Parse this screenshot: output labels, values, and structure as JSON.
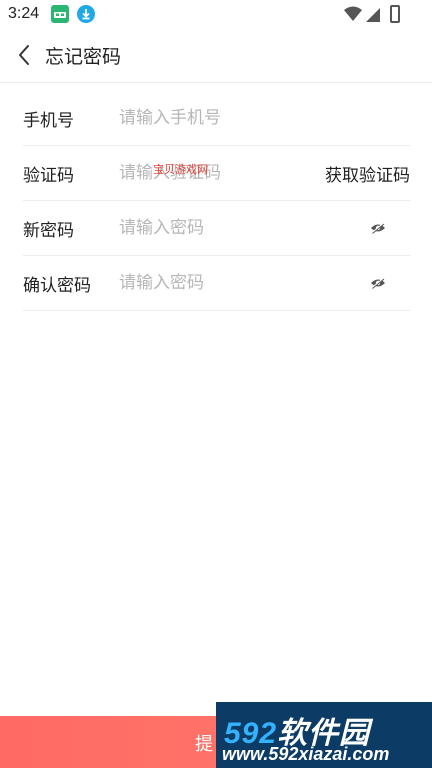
{
  "status_bar": {
    "time": "3:24"
  },
  "header": {
    "title": "忘记密码"
  },
  "form": {
    "phone": {
      "label": "手机号",
      "placeholder": "请输入手机号"
    },
    "code": {
      "label": "验证码",
      "placeholder": "请输入验证码",
      "get_code": "获取验证码"
    },
    "new_password": {
      "label": "新密码",
      "placeholder": "请输入密码"
    },
    "confirm_password": {
      "label": "确认密码",
      "placeholder": "请输入密码"
    }
  },
  "watermark": {
    "text": "宝贝游戏网"
  },
  "submit": {
    "label": "提"
  },
  "brand": {
    "logo_num": "592",
    "logo_text": "软件园",
    "url": "www.592xiazai.com"
  },
  "colors": {
    "submit_bar": "#ff6a64",
    "brand_bg": "#0c3b66",
    "brand_accent": "#33b3ff",
    "app_icon": "#2bb673",
    "download_icon": "#20a8e8"
  },
  "icons": {
    "back": "chevron-left-icon",
    "eye": "eye-off-icon",
    "wifi": "wifi-icon",
    "signal": "signal-icon",
    "battery": "battery-icon",
    "app": "app-icon",
    "download": "download-icon"
  }
}
